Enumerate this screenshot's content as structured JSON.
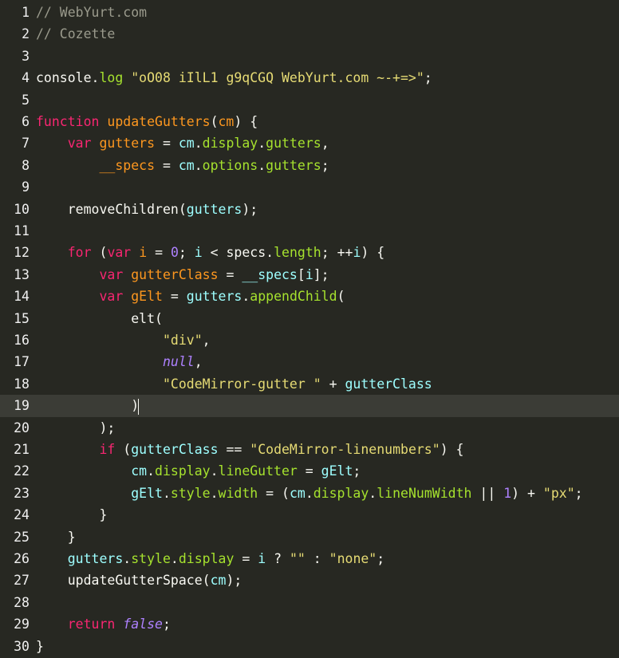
{
  "editor": {
    "theme": {
      "background": "#272822",
      "active_line": "#3b3c36",
      "comment": "#9a9a8c",
      "keyword": "#f92672",
      "def": "#fd971f",
      "property": "#a6e22e",
      "string": "#e6db74",
      "number": "#ae81ff",
      "variable2": "#9effff",
      "text": "#f8f8f2"
    },
    "active_line_number": 19,
    "lines": [
      {
        "n": "1",
        "tokens": [
          [
            "comment",
            "// WebYurt.com"
          ]
        ]
      },
      {
        "n": "2",
        "tokens": [
          [
            "comment",
            "// Cozette"
          ]
        ]
      },
      {
        "n": "3",
        "tokens": []
      },
      {
        "n": "4",
        "tokens": [
          [
            "var",
            "console"
          ],
          [
            "punct",
            "."
          ],
          [
            "prop",
            "log"
          ],
          [
            "punct",
            " "
          ],
          [
            "string",
            "\"oO08 iIlL1 g9qCGQ WebYurt.com ~-+=>\""
          ],
          [
            "punct",
            ";"
          ]
        ]
      },
      {
        "n": "5",
        "tokens": []
      },
      {
        "n": "6",
        "tokens": [
          [
            "keyword",
            "function"
          ],
          [
            "punct",
            " "
          ],
          [
            "def",
            "updateGutters"
          ],
          [
            "punct",
            "("
          ],
          [
            "param",
            "cm"
          ],
          [
            "punct",
            ") {"
          ]
        ]
      },
      {
        "n": "7",
        "tokens": [
          [
            "punct",
            "    "
          ],
          [
            "keyword",
            "var"
          ],
          [
            "punct",
            " "
          ],
          [
            "def",
            "gutters"
          ],
          [
            "punct",
            " "
          ],
          [
            "operator",
            "="
          ],
          [
            "punct",
            " "
          ],
          [
            "var2",
            "cm"
          ],
          [
            "punct",
            "."
          ],
          [
            "prop",
            "display"
          ],
          [
            "punct",
            "."
          ],
          [
            "prop",
            "gutters"
          ],
          [
            "punct",
            ","
          ]
        ]
      },
      {
        "n": "8",
        "tokens": [
          [
            "punct",
            "        "
          ],
          [
            "def",
            "__specs"
          ],
          [
            "punct",
            " "
          ],
          [
            "operator",
            "="
          ],
          [
            "punct",
            " "
          ],
          [
            "var2",
            "cm"
          ],
          [
            "punct",
            "."
          ],
          [
            "prop",
            "options"
          ],
          [
            "punct",
            "."
          ],
          [
            "prop",
            "gutters"
          ],
          [
            "punct",
            ";"
          ]
        ]
      },
      {
        "n": "9",
        "tokens": []
      },
      {
        "n": "10",
        "tokens": [
          [
            "punct",
            "    "
          ],
          [
            "var",
            "removeChildren"
          ],
          [
            "punct",
            "("
          ],
          [
            "var2",
            "gutters"
          ],
          [
            "punct",
            ");"
          ]
        ]
      },
      {
        "n": "11",
        "tokens": []
      },
      {
        "n": "12",
        "tokens": [
          [
            "punct",
            "    "
          ],
          [
            "keyword",
            "for"
          ],
          [
            "punct",
            " ("
          ],
          [
            "keyword",
            "var"
          ],
          [
            "punct",
            " "
          ],
          [
            "def",
            "i"
          ],
          [
            "punct",
            " "
          ],
          [
            "operator",
            "="
          ],
          [
            "punct",
            " "
          ],
          [
            "number",
            "0"
          ],
          [
            "punct",
            "; "
          ],
          [
            "var2",
            "i"
          ],
          [
            "punct",
            " "
          ],
          [
            "operator",
            "<"
          ],
          [
            "punct",
            " "
          ],
          [
            "var",
            "specs"
          ],
          [
            "punct",
            "."
          ],
          [
            "prop",
            "length"
          ],
          [
            "punct",
            "; "
          ],
          [
            "operator",
            "++"
          ],
          [
            "var2",
            "i"
          ],
          [
            "punct",
            ") {"
          ]
        ]
      },
      {
        "n": "13",
        "tokens": [
          [
            "punct",
            "        "
          ],
          [
            "keyword",
            "var"
          ],
          [
            "punct",
            " "
          ],
          [
            "def",
            "gutterClass"
          ],
          [
            "punct",
            " "
          ],
          [
            "operator",
            "="
          ],
          [
            "punct",
            " "
          ],
          [
            "var2",
            "__specs"
          ],
          [
            "punct",
            "["
          ],
          [
            "var2",
            "i"
          ],
          [
            "punct",
            "];"
          ]
        ]
      },
      {
        "n": "14",
        "tokens": [
          [
            "punct",
            "        "
          ],
          [
            "keyword",
            "var"
          ],
          [
            "punct",
            " "
          ],
          [
            "def",
            "gElt"
          ],
          [
            "punct",
            " "
          ],
          [
            "operator",
            "="
          ],
          [
            "punct",
            " "
          ],
          [
            "var2",
            "gutters"
          ],
          [
            "punct",
            "."
          ],
          [
            "prop",
            "appendChild"
          ],
          [
            "punct",
            "("
          ]
        ]
      },
      {
        "n": "15",
        "tokens": [
          [
            "punct",
            "            "
          ],
          [
            "var",
            "elt"
          ],
          [
            "punct",
            "("
          ]
        ]
      },
      {
        "n": "16",
        "tokens": [
          [
            "punct",
            "                "
          ],
          [
            "string",
            "\"div\""
          ],
          [
            "punct",
            ","
          ]
        ]
      },
      {
        "n": "17",
        "tokens": [
          [
            "punct",
            "                "
          ],
          [
            "atom",
            "null"
          ],
          [
            "punct",
            ","
          ]
        ]
      },
      {
        "n": "18",
        "tokens": [
          [
            "punct",
            "                "
          ],
          [
            "string",
            "\"CodeMirror-gutter \""
          ],
          [
            "punct",
            " "
          ],
          [
            "operator",
            "+"
          ],
          [
            "punct",
            " "
          ],
          [
            "var2",
            "gutterClass"
          ]
        ]
      },
      {
        "n": "19",
        "tokens": [
          [
            "punct",
            "            "
          ],
          [
            "punct",
            ")"
          ]
        ]
      },
      {
        "n": "20",
        "tokens": [
          [
            "punct",
            "        "
          ],
          [
            "punct",
            ");"
          ]
        ]
      },
      {
        "n": "21",
        "tokens": [
          [
            "punct",
            "        "
          ],
          [
            "keyword",
            "if"
          ],
          [
            "punct",
            " ("
          ],
          [
            "var2",
            "gutterClass"
          ],
          [
            "punct",
            " "
          ],
          [
            "operator",
            "=="
          ],
          [
            "punct",
            " "
          ],
          [
            "string",
            "\"CodeMirror-linenumbers\""
          ],
          [
            "punct",
            ") {"
          ]
        ]
      },
      {
        "n": "22",
        "tokens": [
          [
            "punct",
            "            "
          ],
          [
            "var2",
            "cm"
          ],
          [
            "punct",
            "."
          ],
          [
            "prop",
            "display"
          ],
          [
            "punct",
            "."
          ],
          [
            "prop",
            "lineGutter"
          ],
          [
            "punct",
            " "
          ],
          [
            "operator",
            "="
          ],
          [
            "punct",
            " "
          ],
          [
            "var2",
            "gElt"
          ],
          [
            "punct",
            ";"
          ]
        ]
      },
      {
        "n": "23",
        "tokens": [
          [
            "punct",
            "            "
          ],
          [
            "var2",
            "gElt"
          ],
          [
            "punct",
            "."
          ],
          [
            "prop",
            "style"
          ],
          [
            "punct",
            "."
          ],
          [
            "prop",
            "width"
          ],
          [
            "punct",
            " "
          ],
          [
            "operator",
            "="
          ],
          [
            "punct",
            " ("
          ],
          [
            "var2",
            "cm"
          ],
          [
            "punct",
            "."
          ],
          [
            "prop",
            "display"
          ],
          [
            "punct",
            "."
          ],
          [
            "prop",
            "lineNumWidth"
          ],
          [
            "punct",
            " "
          ],
          [
            "operator",
            "||"
          ],
          [
            "punct",
            " "
          ],
          [
            "number",
            "1"
          ],
          [
            "punct",
            ") "
          ],
          [
            "operator",
            "+"
          ],
          [
            "punct",
            " "
          ],
          [
            "string",
            "\"px\""
          ],
          [
            "punct",
            ";"
          ]
        ]
      },
      {
        "n": "24",
        "tokens": [
          [
            "punct",
            "        "
          ],
          [
            "punct",
            "}"
          ]
        ]
      },
      {
        "n": "25",
        "tokens": [
          [
            "punct",
            "    "
          ],
          [
            "punct",
            "}"
          ]
        ]
      },
      {
        "n": "26",
        "tokens": [
          [
            "punct",
            "    "
          ],
          [
            "var2",
            "gutters"
          ],
          [
            "punct",
            "."
          ],
          [
            "prop",
            "style"
          ],
          [
            "punct",
            "."
          ],
          [
            "prop",
            "display"
          ],
          [
            "punct",
            " "
          ],
          [
            "operator",
            "="
          ],
          [
            "punct",
            " "
          ],
          [
            "var2",
            "i"
          ],
          [
            "punct",
            " "
          ],
          [
            "operator",
            "?"
          ],
          [
            "punct",
            " "
          ],
          [
            "string",
            "\"\""
          ],
          [
            "punct",
            " "
          ],
          [
            "operator",
            ":"
          ],
          [
            "punct",
            " "
          ],
          [
            "string",
            "\"none\""
          ],
          [
            "punct",
            ";"
          ]
        ]
      },
      {
        "n": "27",
        "tokens": [
          [
            "punct",
            "    "
          ],
          [
            "var",
            "updateGutterSpace"
          ],
          [
            "punct",
            "("
          ],
          [
            "var2",
            "cm"
          ],
          [
            "punct",
            ");"
          ]
        ]
      },
      {
        "n": "28",
        "tokens": []
      },
      {
        "n": "29",
        "tokens": [
          [
            "punct",
            "    "
          ],
          [
            "keyword",
            "return"
          ],
          [
            "punct",
            " "
          ],
          [
            "atom",
            "false"
          ],
          [
            "punct",
            ";"
          ]
        ]
      },
      {
        "n": "30",
        "tokens": [
          [
            "punct",
            "}"
          ]
        ]
      }
    ]
  }
}
